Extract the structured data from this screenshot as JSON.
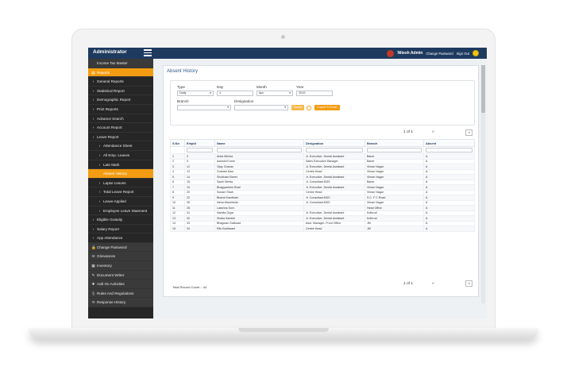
{
  "app": {
    "brand": "Administrator",
    "user_name": "Nitesh Admin",
    "change_password": "Change Password",
    "sign_out": "Sign Out"
  },
  "sidebar": {
    "items": [
      {
        "label": "Income Tax Master",
        "style": "dark",
        "prefix": ""
      },
      {
        "label": "Reports",
        "style": "orange",
        "prefix": "▤"
      },
      {
        "label": "General Reports",
        "style": "",
        "prefix": "›"
      },
      {
        "label": "Statistical Report",
        "style": "",
        "prefix": "›"
      },
      {
        "label": "Demographic Report",
        "style": "",
        "prefix": "›"
      },
      {
        "label": "Print Reports",
        "style": "",
        "prefix": "›"
      },
      {
        "label": "Advance Search",
        "style": "",
        "prefix": "›"
      },
      {
        "label": "Account Report",
        "style": "",
        "prefix": "›"
      },
      {
        "label": "Leave Report",
        "style": "",
        "prefix": "›"
      },
      {
        "label": "Attendance Sheet",
        "style": "sub",
        "prefix": "›"
      },
      {
        "label": "All Emp. Leaves",
        "style": "sub",
        "prefix": "›"
      },
      {
        "label": "Late Mark",
        "style": "sub",
        "prefix": "›"
      },
      {
        "label": "Absent History",
        "style": "sub orange",
        "prefix": ""
      },
      {
        "label": "Lapse Leaves",
        "style": "sub",
        "prefix": "›"
      },
      {
        "label": "Total Leave Report",
        "style": "sub",
        "prefix": "›"
      },
      {
        "label": "Leave Applied",
        "style": "sub",
        "prefix": "›"
      },
      {
        "label": "Employee Leave Staement",
        "style": "sub",
        "prefix": "›"
      },
      {
        "label": "Eligible Gratuity",
        "style": "",
        "prefix": "›"
      },
      {
        "label": "Salary Report",
        "style": "",
        "prefix": "›"
      },
      {
        "label": "App Attendance",
        "style": "",
        "prefix": "›"
      },
      {
        "label": "Change Password",
        "style": "dark",
        "prefix": "🔒"
      },
      {
        "label": "Grievances",
        "style": "dark",
        "prefix": "✉"
      },
      {
        "label": "Inventory",
        "style": "dark",
        "prefix": "▦"
      },
      {
        "label": "Document Writer",
        "style": "dark",
        "prefix": "✎"
      },
      {
        "label": "Add On Activities",
        "style": "dark",
        "prefix": "✚"
      },
      {
        "label": "Rules And Regulations",
        "style": "dark",
        "prefix": "§"
      },
      {
        "label": "Response History",
        "style": "dark",
        "prefix": "⟲"
      }
    ]
  },
  "page": {
    "title": "Absent History",
    "filters": {
      "type_label": "Type",
      "type_value": "Daily",
      "day_label": "Day",
      "day_value": "1",
      "month_label": "Month",
      "month_value": "Apr",
      "year_label": "Year",
      "year_value": "2019",
      "branch_label": "Branch",
      "designation_label": "Designation",
      "search_btn": "Search",
      "export_btn": "Export To Excel"
    },
    "pager": {
      "text": "1 of 1"
    },
    "table": {
      "headers": [
        "S.No",
        "Empld",
        "Name",
        "Designation",
        "Branch",
        "Absent"
      ],
      "rows": [
        [
          "1",
          "3",
          "Anita Mishra",
          "Jr. Executive- Dental Assistant",
          "Baner",
          "A"
        ],
        [
          "2",
          "5",
          "Ashwini Kurne",
          "Sales Executive Manager",
          "Baner",
          "A"
        ],
        [
          "3",
          "12",
          "Vijay Chavan",
          "Jr. Executive- Dental Assistant",
          "Viman Nagar",
          "A"
        ],
        [
          "4",
          "13",
          "Gurbani Kaur",
          "Centre Head",
          "Viman Nagar",
          "A"
        ],
        [
          "5",
          "14",
          "Shubham Baner",
          "Jr. Executive- Dental Assistant",
          "Viman Nagar",
          "A"
        ],
        [
          "6",
          "15",
          "Sachi Mehta",
          "Jr. Consultant-BDS",
          "Baner",
          "A"
        ],
        [
          "7",
          "19",
          "Bhagyashree Bhat",
          "Jr. Executive- Dental Assistant",
          "Viman Nagar",
          "A"
        ],
        [
          "8",
          "20",
          "Sonam Shah",
          "Centre Head",
          "Viman Nagar",
          "A"
        ],
        [
          "9",
          "22",
          "Bharat Kandhare",
          "Jr. Consultant-BDS",
          "S.C. F C Road",
          "A"
        ],
        [
          "10",
          "26",
          "Neha Wanhhede",
          "Jr. Consultant-BDS",
          "Viman Nagar",
          "A"
        ],
        [
          "11",
          "28",
          "Lakshna Soni",
          "",
          "Head Office",
          "A"
        ],
        [
          "12",
          "31",
          "Namita Gujar",
          "Jr. Executive- Dental Assistant",
          "Kothrud",
          "A"
        ],
        [
          "13",
          "32",
          "Shaila Kamble",
          "Jr. Executive- Dental Assistant",
          "Kothrud",
          "A"
        ],
        [
          "14",
          "33",
          "Bhagwan Gaikwad",
          "Asst. Manager- Front Office",
          "JM",
          "A"
        ],
        [
          "15",
          "34",
          "Ritu Budhwani",
          "Centre Head",
          "JM",
          "A"
        ]
      ]
    },
    "total_record": "Total Record Count :- 44"
  }
}
